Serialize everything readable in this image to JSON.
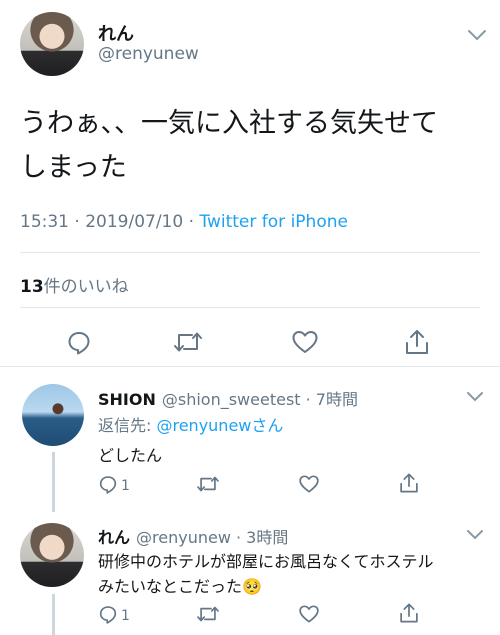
{
  "main_tweet": {
    "display_name": "れん",
    "handle": "@renyunew",
    "text_line1": "うわぁ、、一気に入社する気失せて",
    "text_line2": "しまった",
    "time": "15:31 · 2019/07/10 · ",
    "source": "Twitter for iPhone",
    "likes_count": "13",
    "likes_label": "件のいいね"
  },
  "replies": [
    {
      "display_name": "SHION",
      "handle_time": "@shion_sweetest · 7時間",
      "reply_to_prefix": "返信先: ",
      "reply_to_handle": "@renyunew",
      "reply_to_suffix": "さん",
      "text": "どしたん",
      "reply_count": "1"
    },
    {
      "display_name": "れん",
      "handle_time": "@renyunew · 3時間",
      "text_line1": "研修中のホテルが部屋にお風呂なくてホステル",
      "text_line2": "みたいなとこだった🥺",
      "reply_count": "1"
    }
  ],
  "icons": [
    "chevron-down-icon",
    "reply-icon",
    "retweet-icon",
    "like-icon",
    "share-icon"
  ],
  "colors": {
    "accent": "#1da1f2",
    "muted": "#657786",
    "text": "#14171a",
    "divider": "#e1e8ed"
  }
}
